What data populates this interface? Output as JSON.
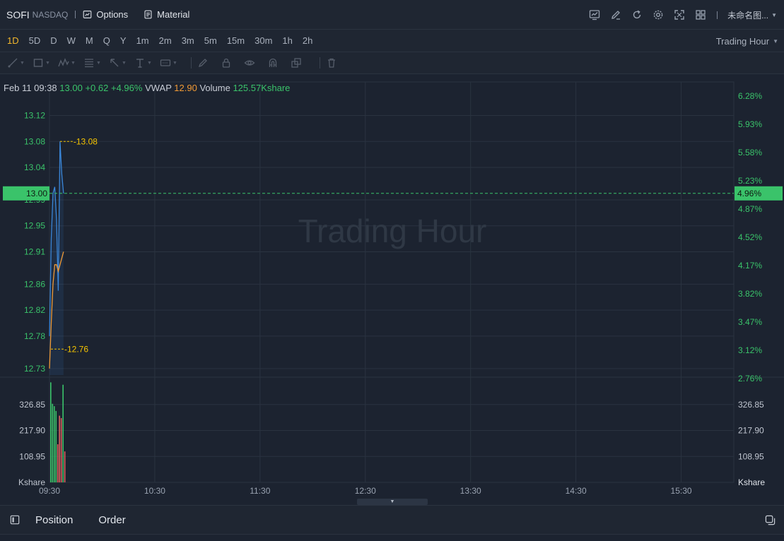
{
  "header": {
    "symbol": "SOFI",
    "exchange": "NASDAQ",
    "options_label": "Options",
    "material_label": "Material",
    "layout_name": "未命名图...",
    "icons": [
      "chart-style-icon",
      "pencil-icon",
      "refresh-icon",
      "settings-icon",
      "fullscreen-icon",
      "grid-layout-icon"
    ]
  },
  "periods": {
    "items": [
      "1D",
      "5D",
      "D",
      "W",
      "M",
      "Q",
      "Y",
      "1m",
      "2m",
      "3m",
      "5m",
      "15m",
      "30m",
      "1h",
      "2h"
    ],
    "active": "1D",
    "session_label": "Trading Hour"
  },
  "info": {
    "date": "Feb 11 09:38",
    "price": "13.00",
    "change": "+0.62",
    "change_pct": "+4.96%",
    "vwap_label": "VWAP",
    "vwap": "12.90",
    "volume_label": "Volume",
    "volume": "125.57Kshare"
  },
  "colors": {
    "up": "#3ac36a",
    "down": "#e0605e",
    "price_line": "#3a86d8",
    "vwap_line": "#f09a35",
    "marker": "#f5c400",
    "background": "#1c2330",
    "grid": "#2a3340"
  },
  "chart_data": {
    "type": "line",
    "watermark": "Trading Hour",
    "x_ticks": [
      "09:30",
      "10:30",
      "11:30",
      "12:30",
      "13:30",
      "14:30",
      "15:30"
    ],
    "x_range": [
      "09:30",
      "16:00"
    ],
    "price_ticks": [
      "13.12",
      "13.08",
      "13.04",
      "12.99",
      "12.95",
      "12.91",
      "12.86",
      "12.82",
      "12.78",
      "12.73"
    ],
    "pct_ticks": [
      "6.28%",
      "5.93%",
      "5.58%",
      "5.23%",
      "4.87%",
      "4.52%",
      "4.17%",
      "3.82%",
      "3.47%",
      "3.12%",
      "2.76%"
    ],
    "ylim": [
      12.72,
      13.15
    ],
    "current_price": "13.00",
    "current_pct": "4.96%",
    "high_label": "13.08",
    "high_value": 13.08,
    "low_label": "12.76",
    "low_value": 12.76,
    "series": [
      {
        "name": "price",
        "x": [
          "09:30",
          "09:31",
          "09:32",
          "09:33",
          "09:34",
          "09:35",
          "09:36",
          "09:37",
          "09:38"
        ],
        "values": [
          12.78,
          12.93,
          13.0,
          13.01,
          12.96,
          12.85,
          13.08,
          13.03,
          13.0
        ]
      },
      {
        "name": "VWAP",
        "x": [
          "09:30",
          "09:31",
          "09:32",
          "09:33",
          "09:34",
          "09:35",
          "09:36",
          "09:37",
          "09:38"
        ],
        "values": [
          12.73,
          12.8,
          12.86,
          12.89,
          12.89,
          12.88,
          12.89,
          12.9,
          12.91
        ]
      }
    ],
    "volume": {
      "unit_label": "Kshare",
      "ticks": [
        "326.85",
        "217.90",
        "108.95"
      ],
      "ylim": [
        0,
        430
      ],
      "bars": [
        {
          "x": "09:30",
          "value": 420,
          "dir": "up"
        },
        {
          "x": "09:31",
          "value": 330,
          "dir": "up"
        },
        {
          "x": "09:32",
          "value": 320,
          "dir": "up"
        },
        {
          "x": "09:33",
          "value": 300,
          "dir": "up"
        },
        {
          "x": "09:34",
          "value": 160,
          "dir": "down"
        },
        {
          "x": "09:35",
          "value": 280,
          "dir": "down"
        },
        {
          "x": "09:36",
          "value": 270,
          "dir": "down"
        },
        {
          "x": "09:37",
          "value": 410,
          "dir": "up"
        },
        {
          "x": "09:38",
          "value": 130,
          "dir": "down"
        }
      ]
    }
  },
  "bottom": {
    "tabs": [
      "Position",
      "Order"
    ]
  }
}
